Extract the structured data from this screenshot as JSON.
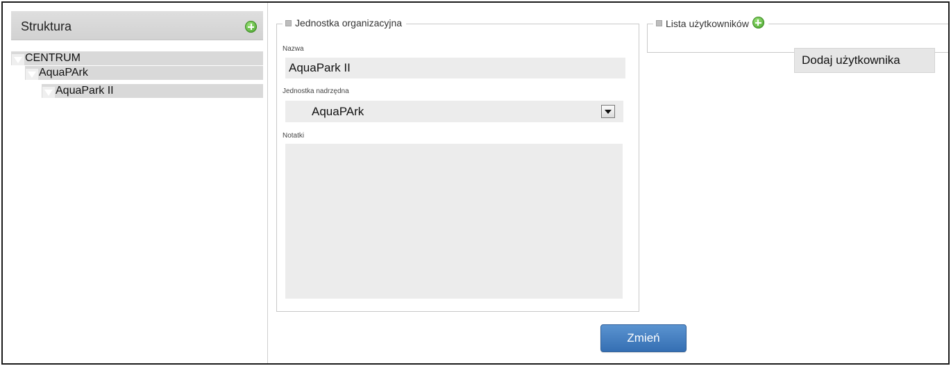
{
  "structure": {
    "title": "Struktura",
    "tree": [
      {
        "label": "CENTRUM",
        "level": 0
      },
      {
        "label": "AquaPArk",
        "level": 1
      },
      {
        "label": "AquaPark II",
        "level": 2
      }
    ]
  },
  "unit_form": {
    "legend": "Jednostka organizacyjna",
    "name_label": "Nazwa",
    "name_value": "AquaPark II",
    "parent_label": "Jednostka nadrzędna",
    "parent_value": "AquaPArk",
    "notes_label": "Notatki",
    "notes_value": ""
  },
  "users": {
    "legend": "Lista użytkowników",
    "add_user_label": "Dodaj użytkownika"
  },
  "actions": {
    "change_label": "Zmień"
  },
  "colors": {
    "primary_button": "#4682c4",
    "add_icon": "#4caf2e",
    "panel_header": "#d8d8d8"
  }
}
